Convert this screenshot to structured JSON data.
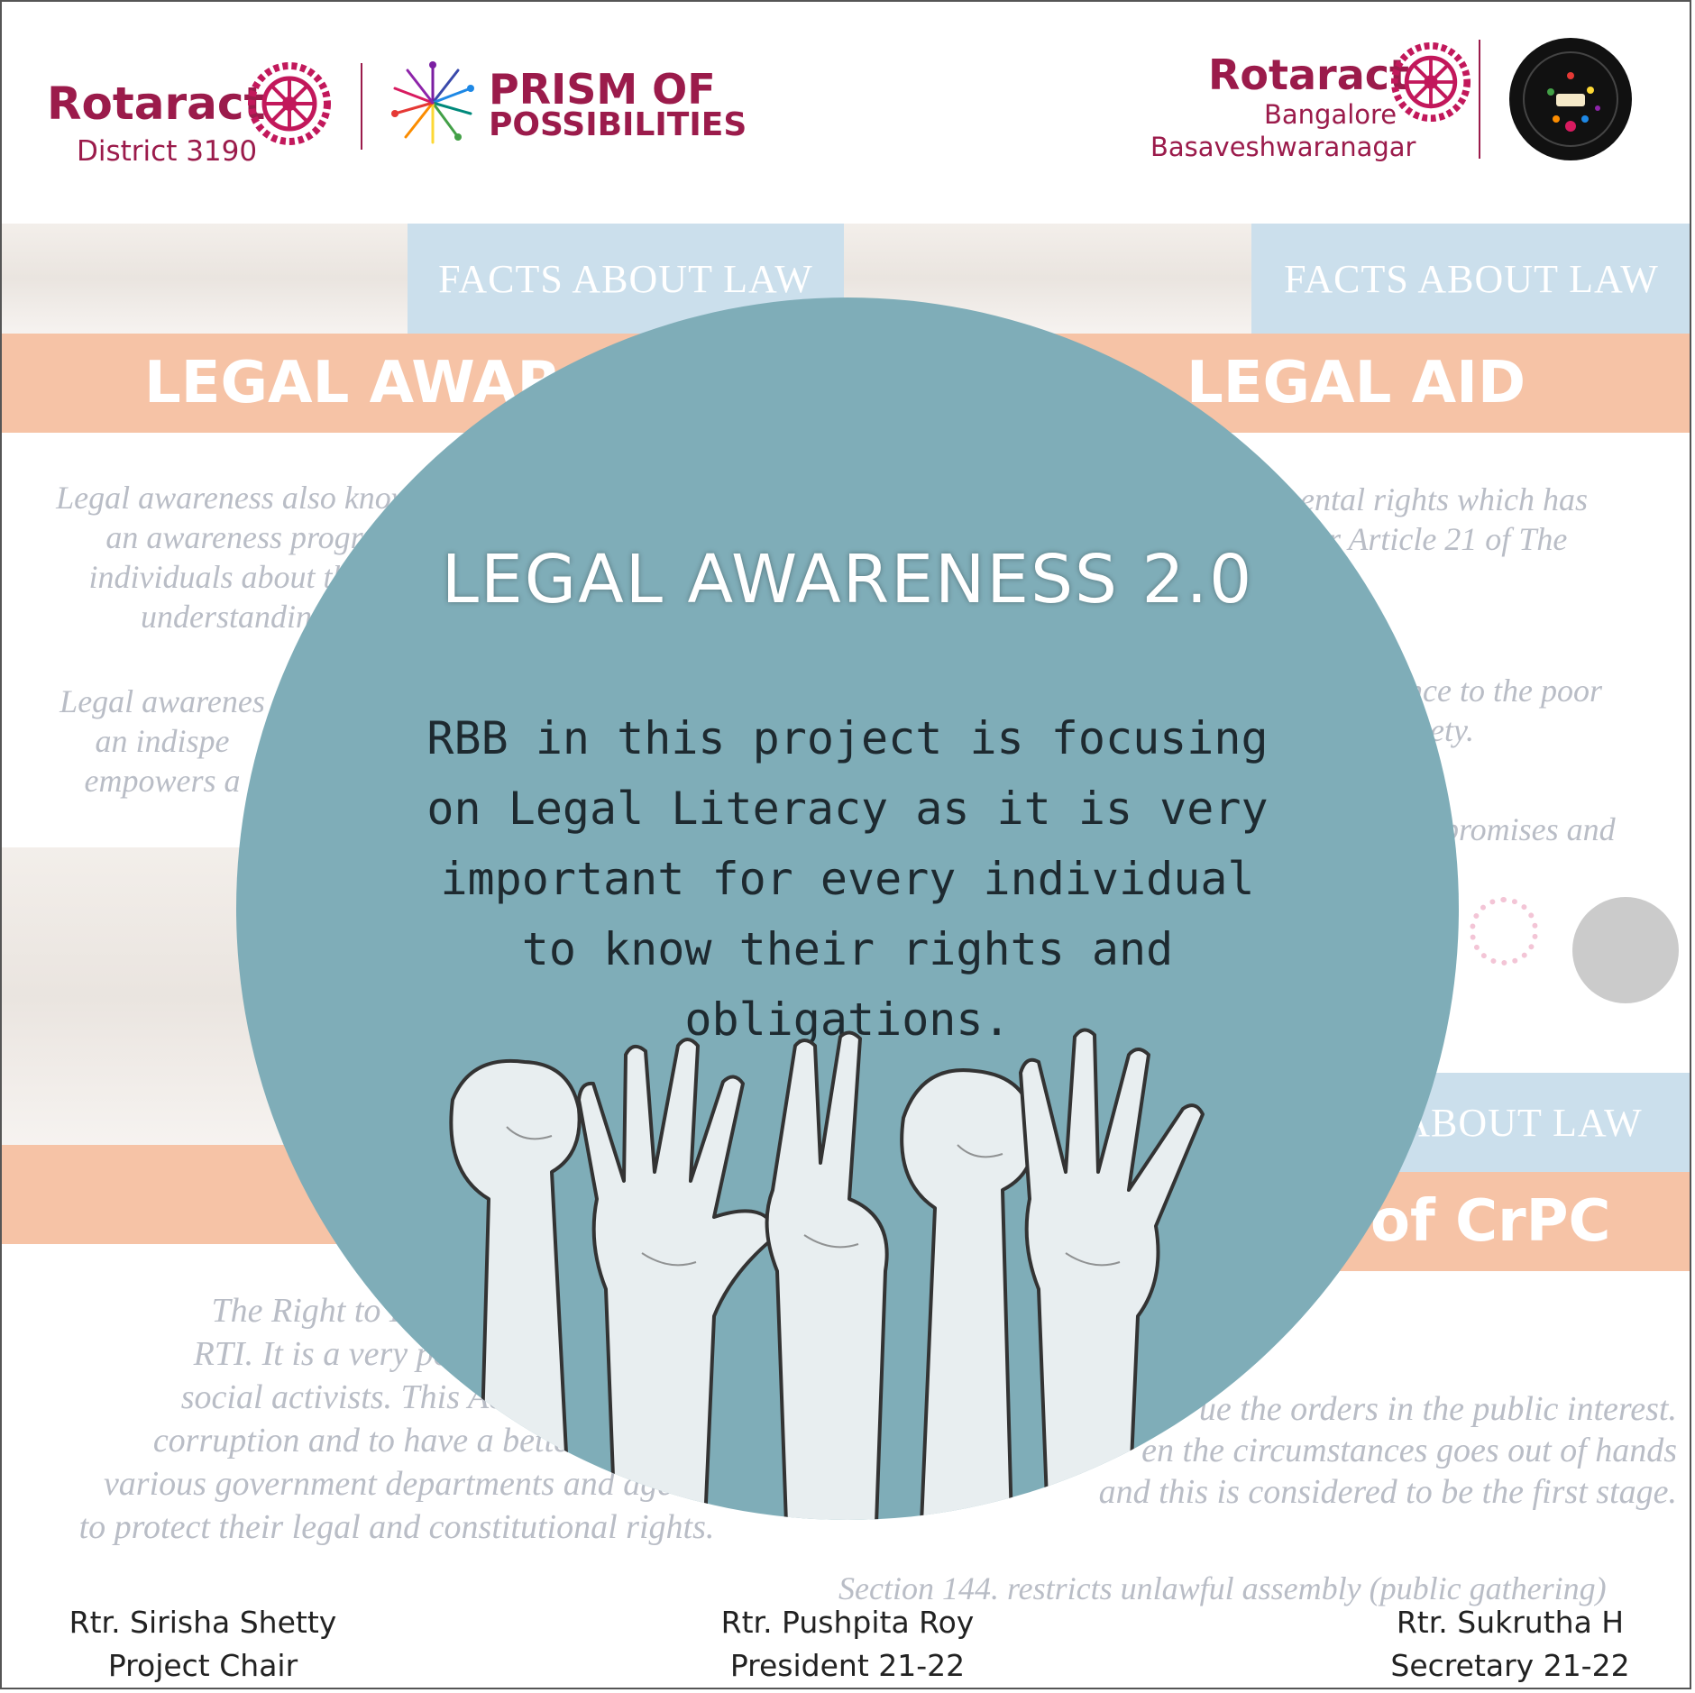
{
  "header": {
    "left_org": "Rotaract",
    "left_district": "District 3190",
    "project_line1": "PRISM OF",
    "project_line2": "POSSIBILITIES",
    "right_org": "Rotaract",
    "right_city": "Bangalore",
    "right_area": "Basaveshwaranagar"
  },
  "background": {
    "band_label": "FACTS ABOUT LAW",
    "bar_left": "LEGAL AWAR",
    "bar_right": "LEGAL AID",
    "bar_bottom_right": "of CrPC",
    "band_bottom_right": "ABOUT LAW",
    "text_left_1": "Legal awareness also know\nan awareness progr\nindividuals about the l\nunderstanding",
    "text_left_2": "Legal awarenes\nan indispe\nempowers a",
    "text_right_1": "damental rights which has\ns under Article 21 of The\ndia.",
    "text_right_2": "nce to the poor\nciety.",
    "text_right_3": "promises and",
    "text_bottom_left": "The Right to Information A\nRTI. It is a very powerful tool\nsocial activists. This Act is bein\ncorruption and to have a better con\nvarious government departments and agen\nto protect their legal and constitutional rights.",
    "text_bottom_right": "ue the orders in the public interest.\nen the circumstances goes out of hands\nand this is considered to be the first stage.",
    "text_bottom_line": "Section 144. restricts unlawful assembly (public gathering)"
  },
  "circle": {
    "title": "LEGAL AWARENESS 2.0",
    "body": "RBB in this project is focusing on Legal Literacy as it is very important for every individual to know their rights and obligations."
  },
  "footer": {
    "people": [
      {
        "name": "Rtr. Sirisha Shetty",
        "role": "Project Chair"
      },
      {
        "name": "Rtr. Pushpita Roy",
        "role": "President 21-22"
      },
      {
        "name": "Rtr. Sukrutha H",
        "role": "Secretary 21-22"
      }
    ]
  },
  "colors": {
    "brand": "#9b1b4b",
    "circle": "#7fadb8",
    "band": "#c6dcea",
    "bar": "#f6c3a6"
  }
}
